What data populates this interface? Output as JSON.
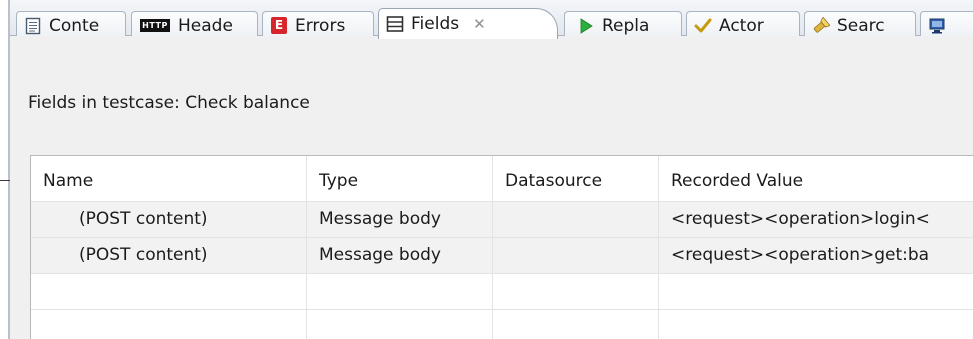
{
  "tabs": [
    {
      "label": "Conte",
      "icon": "document-icon"
    },
    {
      "label": "Heade",
      "icon": "http-icon",
      "icon_text": "HTTP"
    },
    {
      "label": "Errors",
      "icon": "error-icon",
      "icon_text": "E"
    },
    {
      "label": "Fields",
      "icon": "fields-list-icon",
      "active": true
    },
    {
      "label": "Repla",
      "icon": "play-icon"
    },
    {
      "label": "Actor",
      "icon": "checkmark-icon"
    },
    {
      "label": "Searc",
      "icon": "search-flashlight-icon"
    },
    {
      "label": "",
      "icon": "monitor-icon"
    }
  ],
  "panel": {
    "heading": "Fields in testcase: Check balance"
  },
  "table": {
    "columns": [
      "Name",
      "Type",
      "Datasource",
      "Recorded Value"
    ],
    "rows": [
      {
        "name": "(POST content)",
        "type": "Message body",
        "datasource": "",
        "recorded_value": "<request><operation>login<"
      },
      {
        "name": "(POST content)",
        "type": "Message body",
        "datasource": "",
        "recorded_value": "<request><operation>get:ba"
      }
    ]
  },
  "colors": {
    "error_red": "#d7262b",
    "play_green": "#2bb03a",
    "check_gold": "#c89a10",
    "tab_border": "#a9b4c0"
  }
}
